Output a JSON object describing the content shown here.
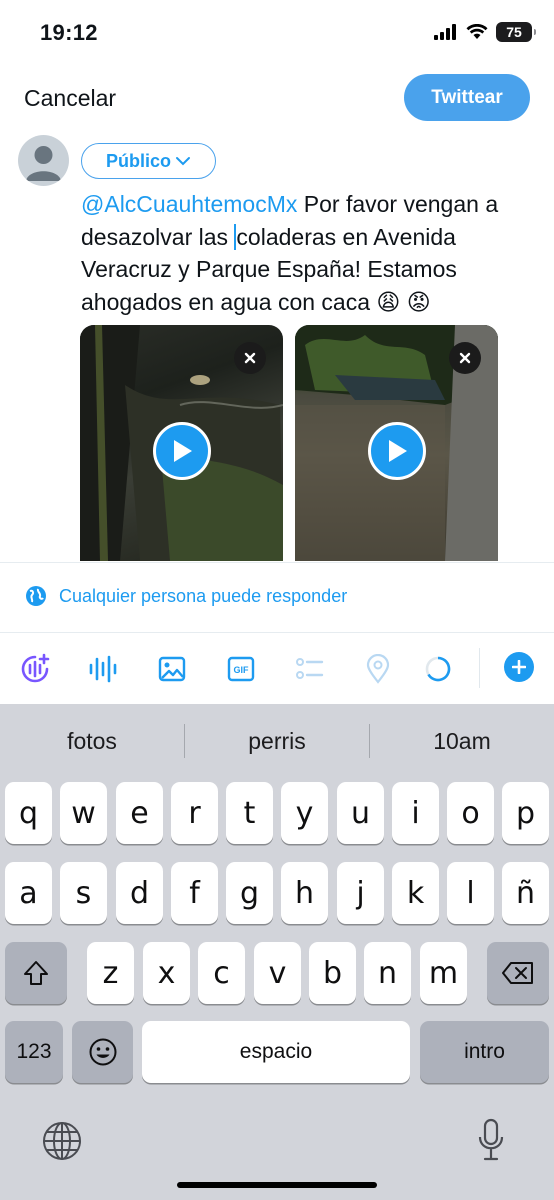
{
  "status_bar": {
    "time": "19:12",
    "battery": "75"
  },
  "header": {
    "cancel_label": "Cancelar",
    "tweet_label": "Twittear"
  },
  "composer": {
    "audience_label": "Público",
    "mention": "@AlcCuauhtemocMx",
    "text_before_cursor": " Por favor vengan a desazolvar las ",
    "text_after_cursor": "coladeras en Avenida Veracruz y Parque España! Estamos ahogados en agua con caca 😩 😡",
    "media": [
      {
        "type": "video",
        "remove_icon": "close-icon",
        "play_icon": "play-icon"
      },
      {
        "type": "video",
        "remove_icon": "close-icon",
        "play_icon": "play-icon"
      }
    ]
  },
  "reply_setting": {
    "label": "Cualquier persona puede responder",
    "icon": "globe-icon"
  },
  "toolbar": {
    "items": [
      "spaces-icon",
      "audio-wave-icon",
      "image-icon",
      "gif-icon",
      "poll-icon",
      "location-icon",
      "char-counter-icon",
      "add-thread-icon"
    ],
    "gif_label": "GIF"
  },
  "keyboard": {
    "suggestions": [
      "fotos",
      "perris",
      "10am"
    ],
    "row1": [
      "q",
      "w",
      "e",
      "r",
      "t",
      "y",
      "u",
      "i",
      "o",
      "p"
    ],
    "row2": [
      "a",
      "s",
      "d",
      "f",
      "g",
      "h",
      "j",
      "k",
      "l",
      "ñ"
    ],
    "row3": [
      "z",
      "x",
      "c",
      "v",
      "b",
      "n",
      "m"
    ],
    "numbers_label": "123",
    "space_label": "espacio",
    "return_label": "intro"
  },
  "colors": {
    "accent": "#1d9bf0",
    "tweet_button": "#4aa2ec",
    "keyboard_bg": "#d2d4da"
  }
}
